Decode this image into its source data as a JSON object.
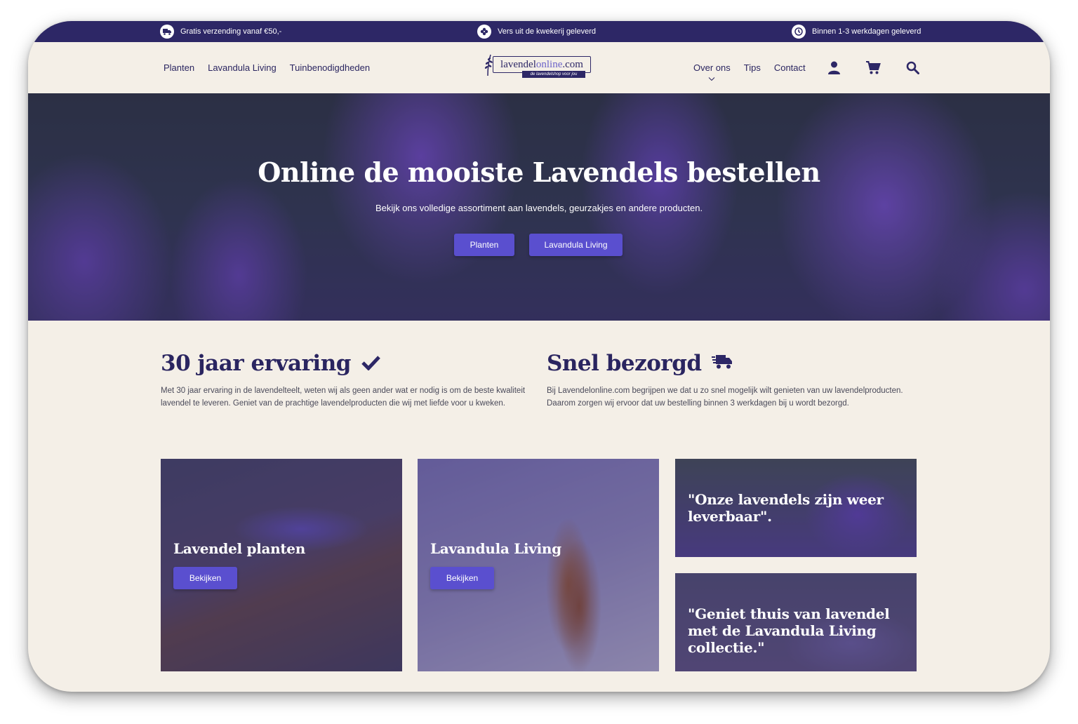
{
  "topbar": {
    "usp1": "Gratis verzending vanaf €50,-",
    "usp2": "Vers uit de kwekerij geleverd",
    "usp3": "Binnen 1-3 werkdagen geleverd"
  },
  "logo": {
    "brand_main": "lavendel",
    "brand_light": "online",
    "brand_tld": ".com",
    "tagline": "de lavendelshop voor jou"
  },
  "nav": {
    "left": [
      "Planten",
      "Lavandula Living",
      "Tuinbenodigdheden"
    ],
    "right": [
      "Over ons",
      "Tips",
      "Contact"
    ]
  },
  "hero": {
    "title": "Online de mooiste Lavendels bestellen",
    "subtitle": "Bekijk ons volledige assortiment aan lavendels, geurzakjes en andere producten.",
    "btn_planten": "Planten",
    "btn_living": "Lavandula Living"
  },
  "features": {
    "f1_title": "30 jaar ervaring",
    "f1_text": "Met 30 jaar ervaring in de lavendelteelt, weten wij als geen ander wat er nodig is om de beste kwaliteit lavendel te leveren. Geniet van de prachtige lavendelproducten die wij met liefde voor u kweken.",
    "f2_title": "Snel bezorgd",
    "f2_text": "Bij Lavendelonline.com begrijpen we dat u zo snel mogelijk wilt genieten van uw lavendelproducten. Daarom zorgen wij ervoor dat uw bestelling binnen 3 werkdagen bij u wordt bezorgd."
  },
  "cards": {
    "c1_title": "Lavendel planten",
    "c1_btn": "Bekijken",
    "c2_title": "Lavandula Living",
    "c2_btn": "Bekijken",
    "c3_title": "\"Onze lavendels zijn weer leverbaar\".",
    "c4_title": "\"Geniet thuis van lavendel met de Lavandula Living collectie.\""
  },
  "icons": {
    "truck": "truck-icon",
    "flower": "flower-icon",
    "clock": "clock-icon",
    "user": "user-icon",
    "cart": "cart-icon",
    "search": "search-icon",
    "check": "check-icon",
    "delivery": "delivery-truck-icon"
  },
  "colors": {
    "primary": "#2d2766",
    "button": "#5a4fcf",
    "background": "#f4efe7"
  }
}
